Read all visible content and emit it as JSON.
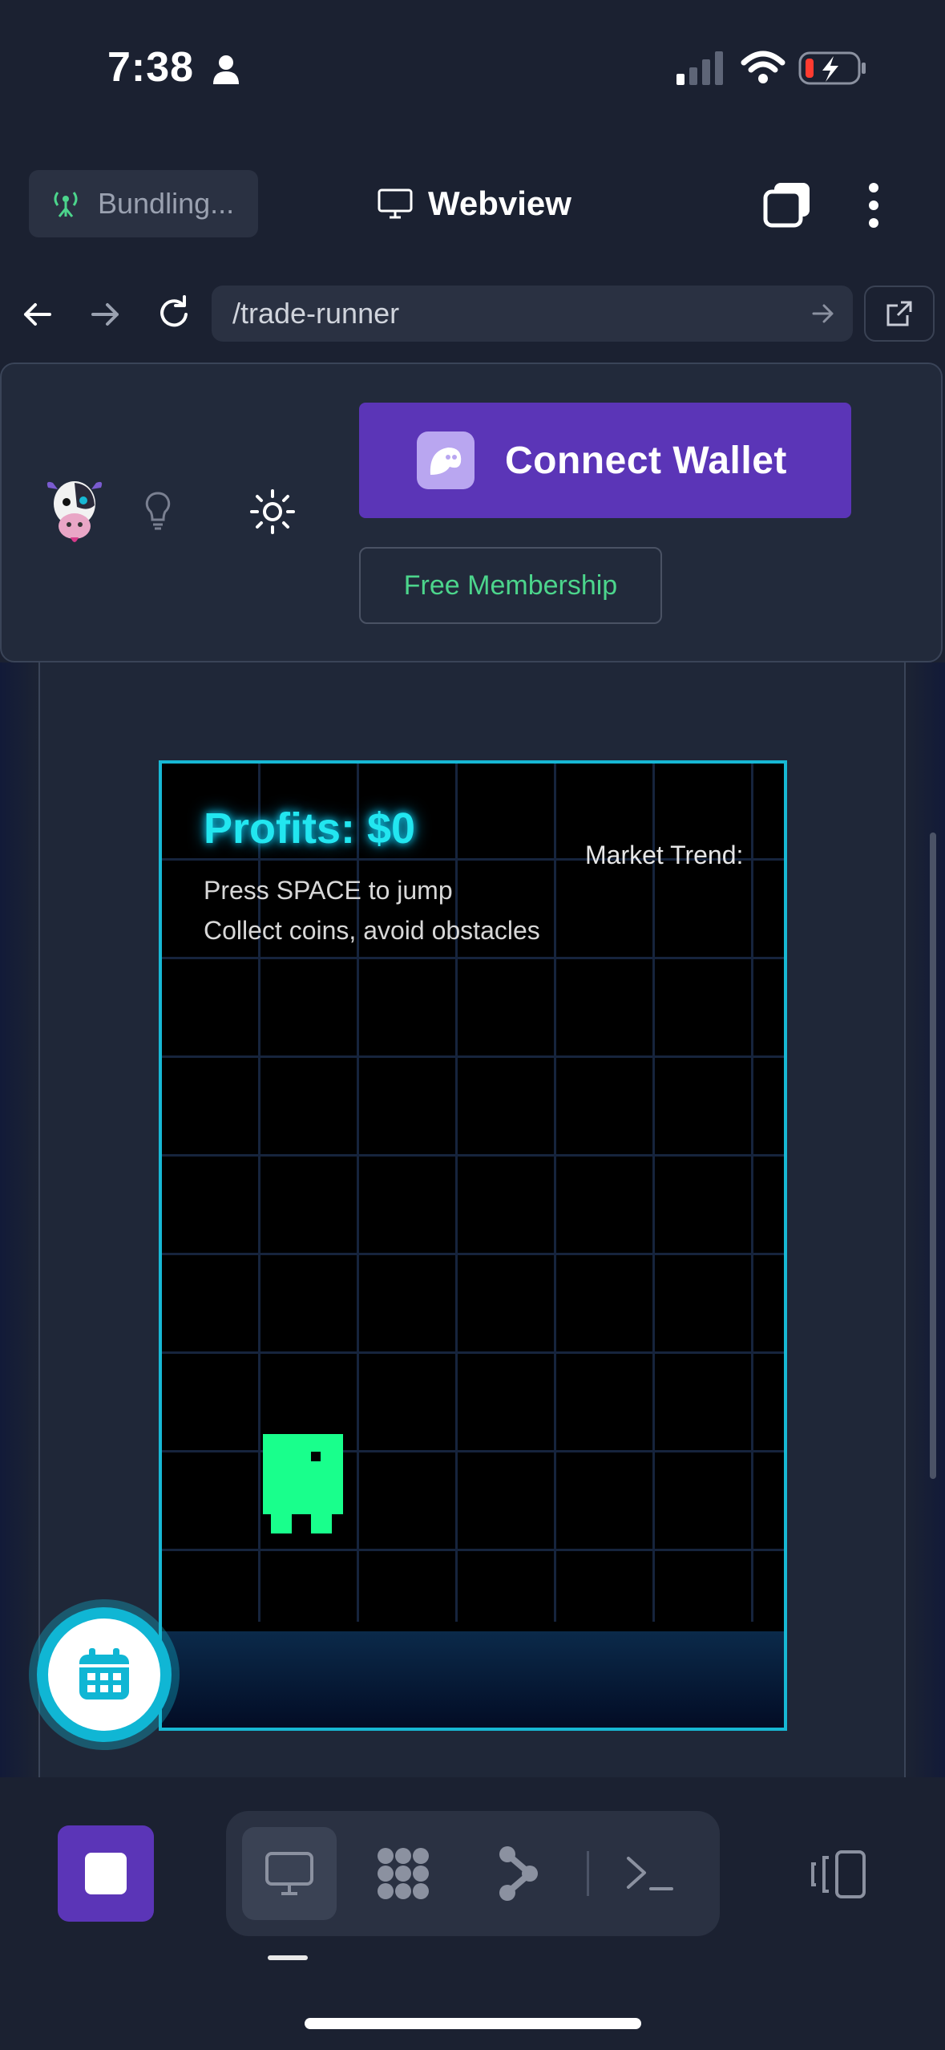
{
  "status_bar": {
    "time": "7:38"
  },
  "app_bar": {
    "bundling_label": "Bundling...",
    "title": "Webview"
  },
  "nav": {
    "url": "/trade-runner"
  },
  "site_header": {
    "connect_label": "Connect Wallet",
    "membership_label": "Free Membership"
  },
  "game": {
    "profits": "Profits: $0",
    "market_trend": "Market Trend:",
    "help_line1": "Press SPACE to jump",
    "help_line2": "Collect coins, avoid obstacles"
  },
  "colors": {
    "accent_purple": "#5b35b7",
    "game_border": "#17b8d4",
    "player_green": "#19ff8c",
    "membership_green": "#4cd58c"
  },
  "icons": {
    "bundling": "antenna-icon",
    "webview": "monitor-icon",
    "tabs": "tabs-icon",
    "menu": "more-vertical-icon",
    "back": "arrow-left-icon",
    "forward": "arrow-right-icon",
    "reload": "reload-icon",
    "go": "arrow-right-icon",
    "external": "external-link-icon",
    "logo": "cow-logo-icon",
    "idea": "lightbulb-icon",
    "theme": "sun-icon",
    "wallet": "ghost-icon",
    "calendar": "calendar-icon",
    "bottom_tabs": [
      "monitor-icon",
      "grid-dots-icon",
      "branch-icon",
      "terminal-icon"
    ],
    "panel": "panel-toggle-icon"
  }
}
